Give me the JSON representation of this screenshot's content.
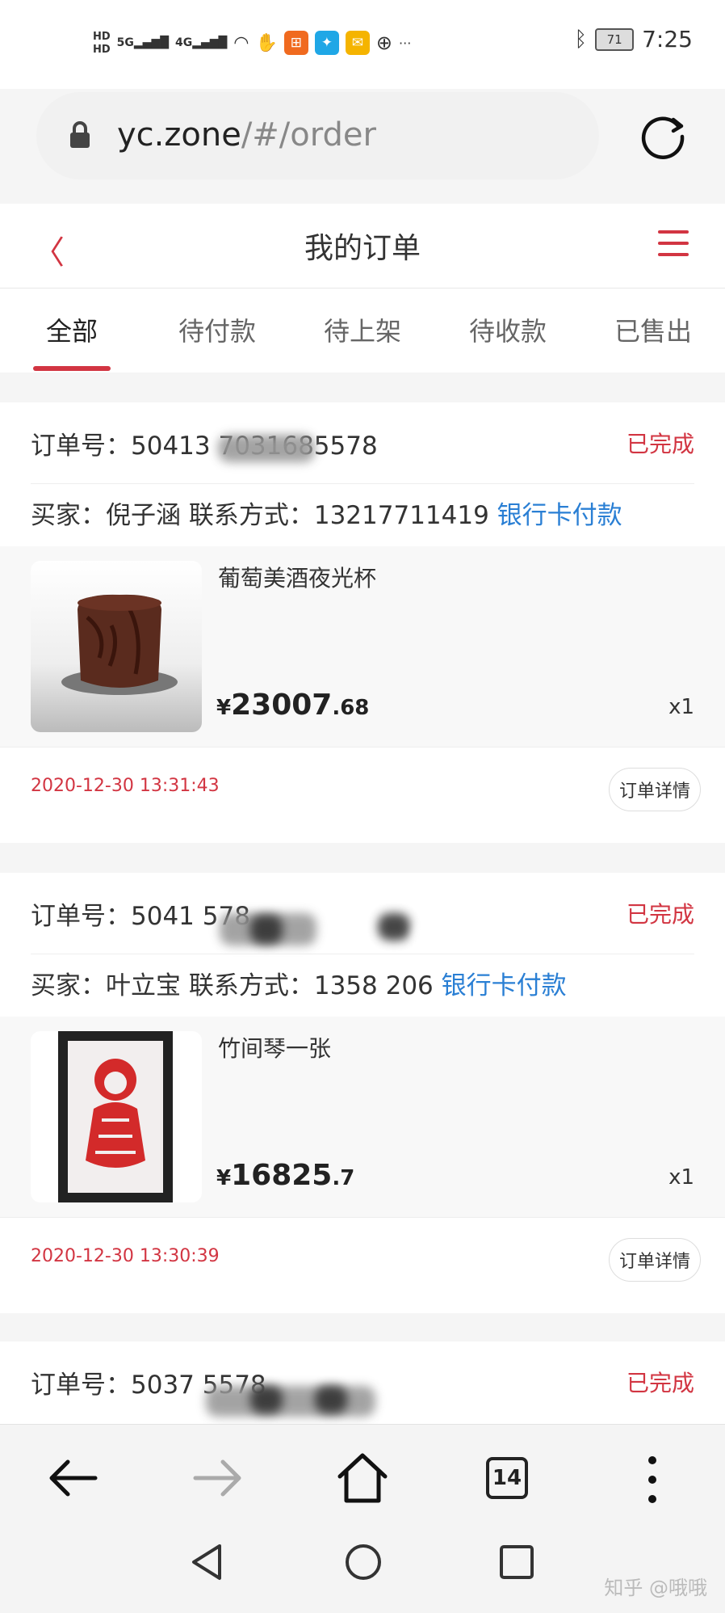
{
  "status_bar": {
    "hd_top": "HD",
    "hd_bottom": "HD",
    "signal1": "5G",
    "signal2": "4G",
    "more": "···",
    "battery": "71",
    "time": "7:25"
  },
  "browser": {
    "url_host": "yc.zone",
    "url_path": "/#/order"
  },
  "header": {
    "title": "我的订单"
  },
  "tabs": [
    "全部",
    "待付款",
    "待上架",
    "待收款",
    "已售出"
  ],
  "orders": [
    {
      "order_no": "订单号：50413        7031685578",
      "status": "已完成",
      "buyer_label": "买家：倪子涵 联系方式：13217711419",
      "pay_method": "银行卡付款",
      "goods_name": "葡萄美酒夜光杯",
      "price_symbol": "¥",
      "price_int": "23007",
      "price_dec": ".68",
      "qty": "x1",
      "time": "2020-12-30 13:31:43",
      "detail_label": "订单详情"
    },
    {
      "order_no": "订单号：5041                        578",
      "status": "已完成",
      "buyer_label": "买家：叶立宝 联系方式：1358       206",
      "pay_method": "银行卡付款",
      "goods_name": "竹间琴一张",
      "price_symbol": "¥",
      "price_int": "16825",
      "price_dec": ".7",
      "qty": "x1",
      "time": "2020-12-30 13:30:39",
      "detail_label": "订单详情"
    },
    {
      "order_no": "订单号：5037                        5578",
      "status": "已完成"
    }
  ],
  "bottom_nav": {
    "tab_count": "14"
  },
  "watermark": "知乎 @哦哦"
}
